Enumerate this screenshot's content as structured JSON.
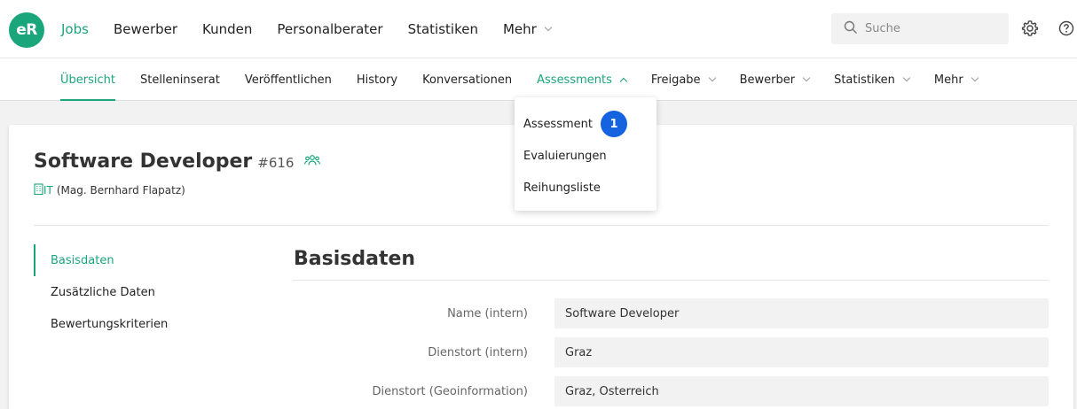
{
  "logo": {
    "text": "eR"
  },
  "main_nav": [
    {
      "label": "Jobs",
      "active": true,
      "has_dropdown": false
    },
    {
      "label": "Bewerber",
      "active": false,
      "has_dropdown": false
    },
    {
      "label": "Kunden",
      "active": false,
      "has_dropdown": false
    },
    {
      "label": "Personalberater",
      "active": false,
      "has_dropdown": false
    },
    {
      "label": "Statistiken",
      "active": false,
      "has_dropdown": false
    },
    {
      "label": "Mehr",
      "active": false,
      "has_dropdown": true
    }
  ],
  "search": {
    "placeholder": "Suche",
    "value": "",
    "icon": "search-icon"
  },
  "top_icons": [
    "gear-icon",
    "help-icon"
  ],
  "sub_nav": [
    {
      "label": "Übersicht",
      "active": true
    },
    {
      "label": "Stelleninserat"
    },
    {
      "label": "Veröffentlichen"
    },
    {
      "label": "History"
    },
    {
      "label": "Konversationen"
    },
    {
      "label": "Assessments",
      "open": true,
      "has_dropdown": true
    },
    {
      "label": "Freigabe",
      "has_dropdown": true
    },
    {
      "label": "Bewerber",
      "has_dropdown": true
    },
    {
      "label": "Statistiken",
      "has_dropdown": true
    },
    {
      "label": "Mehr",
      "has_dropdown": true
    }
  ],
  "dropdown": {
    "items": [
      {
        "label": "Assessment",
        "badge": "1"
      },
      {
        "label": "Evaluierungen"
      },
      {
        "label": "Reihungsliste"
      }
    ]
  },
  "job": {
    "title": "Software Developer",
    "id": "#616",
    "dept_code": "IT",
    "dept_contact": "(Mag. Bernhard Flapatz)"
  },
  "side_nav": [
    {
      "label": "Basisdaten",
      "active": true
    },
    {
      "label": "Zusätzliche Daten"
    },
    {
      "label": "Bewertungskriterien"
    }
  ],
  "section": {
    "title": "Basisdaten",
    "fields": [
      {
        "label": "Name (intern)",
        "value": "Software Developer"
      },
      {
        "label": "Dienstort (intern)",
        "value": "Graz"
      },
      {
        "label": "Dienstort (Geoinformation)",
        "value": "Graz, Österreich"
      }
    ]
  },
  "colors": {
    "accent": "#1aa67a",
    "badge": "#1663e0"
  }
}
